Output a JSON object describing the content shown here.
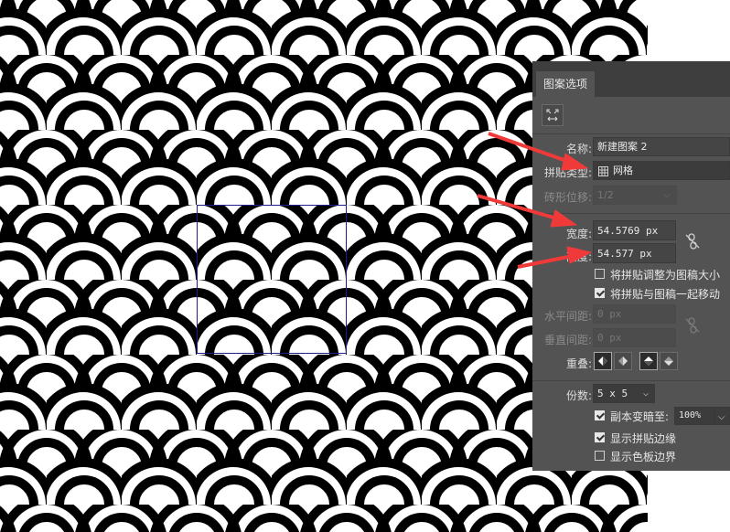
{
  "panel": {
    "tab_label": "图案选项",
    "name_label": "名称:",
    "name_value": "新建图案 2",
    "tile_type_label": "拼贴类型:",
    "tile_type_value": "网格",
    "brick_offset_label": "砖形位移:",
    "brick_offset_value": "1/2",
    "width_label": "宽度:",
    "width_value": "54.5769 px",
    "height_label": "高度:",
    "height_value": "54.577 px",
    "resize_tile_label": "将拼贴调整为图稿大小",
    "resize_tile_checked": false,
    "move_tile_label": "将拼贴与图稿一起移动",
    "move_tile_checked": true,
    "h_spacing_label": "水平间距:",
    "h_spacing_value": "0 px",
    "v_spacing_label": "垂直间距:",
    "v_spacing_value": "0 px",
    "overlap_label": "重叠:",
    "copies_label": "份数:",
    "copies_value": "5 x 5",
    "dim_copies_label": "副本变暗至:",
    "dim_copies_checked": true,
    "dim_copies_value": "100%",
    "show_tile_edge_label": "显示拼贴边缘",
    "show_tile_edge_checked": true,
    "show_swatch_bounds_label": "显示色板边界",
    "show_swatch_bounds_checked": false
  },
  "colors": {
    "panel_bg": "#535353",
    "tile_box": "#1e1e8c",
    "arrow": "#f03a3a"
  },
  "icons": {
    "tile_tool": "pattern-tile-tool-icon",
    "grid": "grid-icon",
    "link": "link-broken-icon"
  }
}
